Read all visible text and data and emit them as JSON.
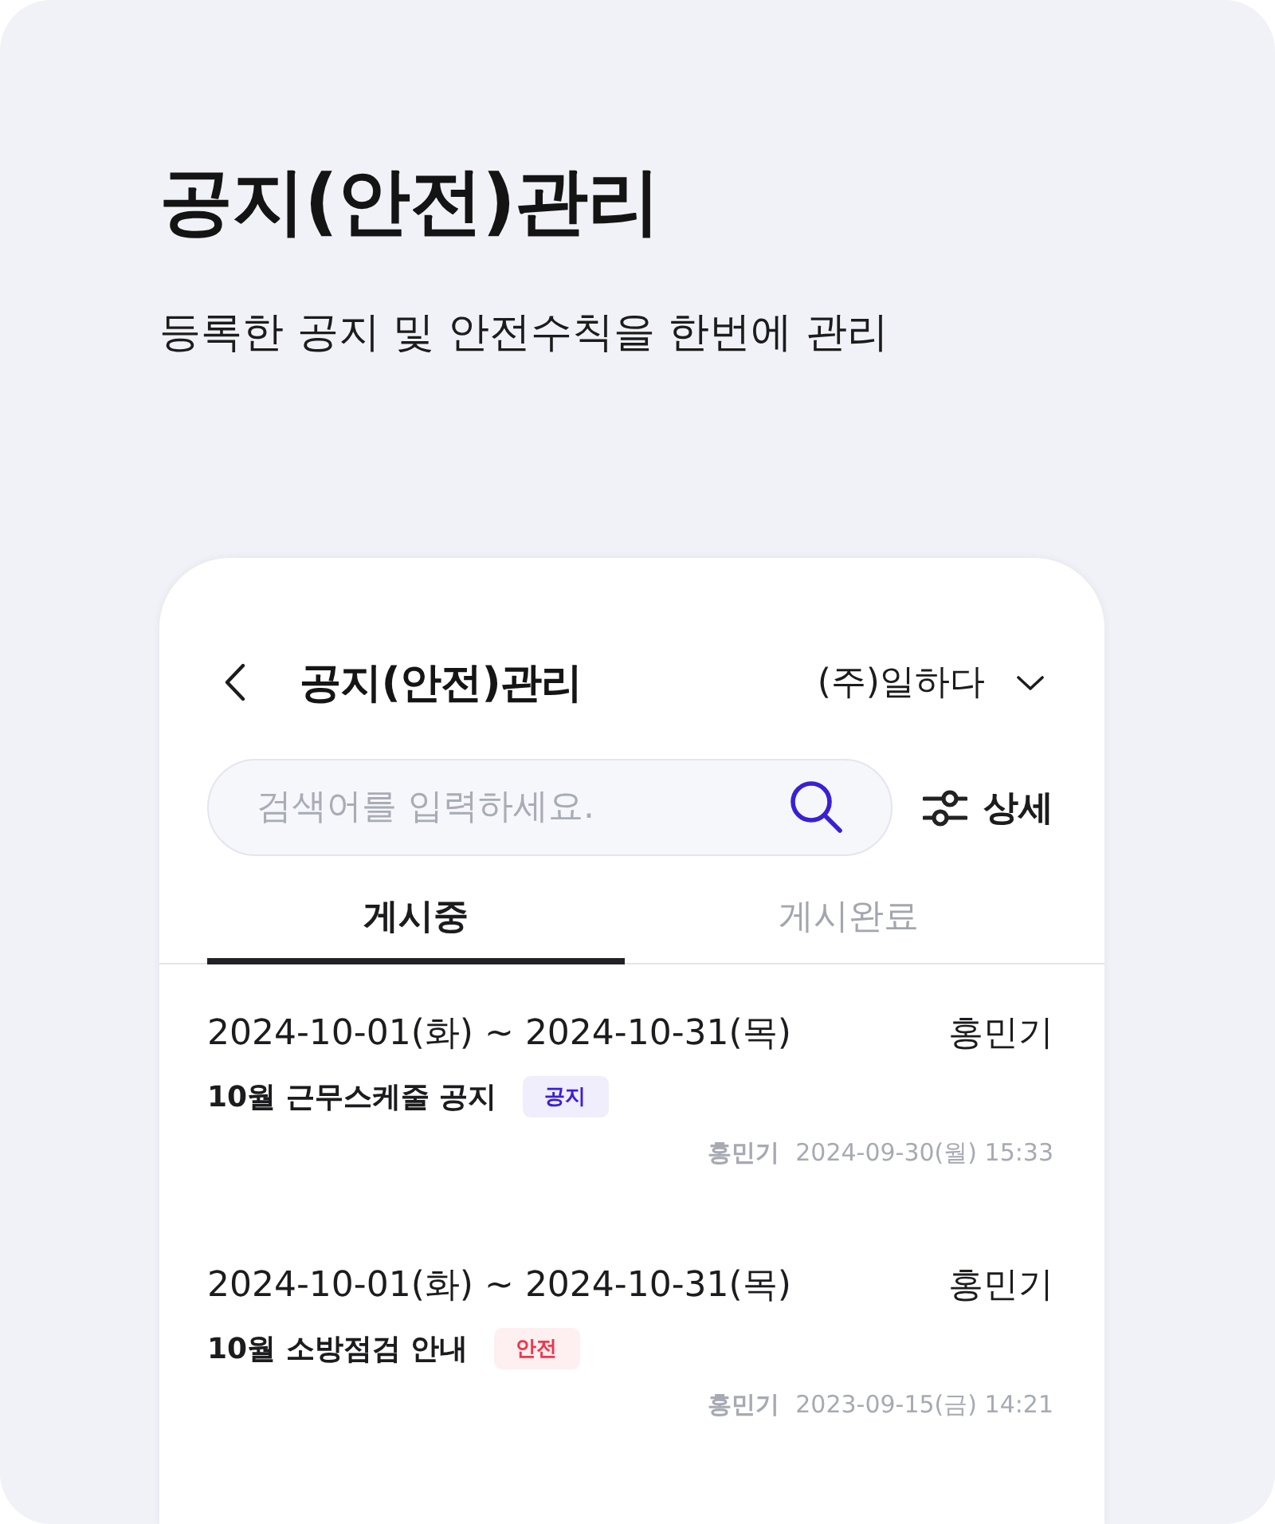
{
  "hero": {
    "title": "공지(안전)관리",
    "subtitle": "등록한 공지 및 안전수칙을 한번에 관리"
  },
  "app_bar": {
    "title": "공지(안전)관리",
    "company": "(주)일하다"
  },
  "search": {
    "placeholder": "검색어를 입력하세요."
  },
  "filter_button": {
    "label": "상세"
  },
  "tabs": [
    {
      "label": "게시중",
      "selected": true
    },
    {
      "label": "게시완료",
      "selected": false
    }
  ],
  "posts": [
    {
      "period": "2024-10-01(화) ~ 2024-10-31(목)",
      "manager": "홍민기",
      "title": "10월 근무스케줄 공지",
      "tag": {
        "label": "공지",
        "color": "#3a1fd6"
      },
      "author": "홍민기",
      "posted_at": "2024-09-30(월) 15:33"
    },
    {
      "period": "2024-10-01(화) ~ 2024-10-31(목)",
      "manager": "홍민기",
      "title": "10월 소방점검 안내",
      "tag": {
        "label": "안전",
        "color": "#f2364a"
      },
      "author": "홍민기",
      "posted_at": "2023-09-15(금) 14:21"
    }
  ]
}
